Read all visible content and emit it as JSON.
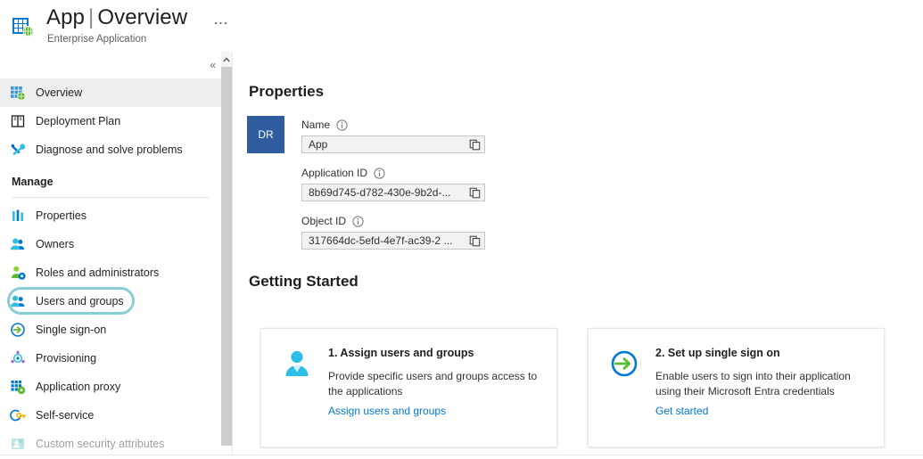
{
  "header": {
    "app_name": "App",
    "separator": "|",
    "page": "Overview",
    "subtitle": "Enterprise Application",
    "ellipsis": "…",
    "icon": "enterprise-application-icon"
  },
  "sidebar": {
    "collapse_label": "«",
    "scroll_up_label": "ⱏ",
    "items": [
      {
        "label": "Overview",
        "icon": "overview-grid-icon",
        "selected": true,
        "disabled": false
      },
      {
        "label": "Deployment Plan",
        "icon": "book-icon",
        "selected": false,
        "disabled": false
      },
      {
        "label": "Diagnose and solve problems",
        "icon": "wrench-screwdriver-icon",
        "selected": false,
        "disabled": false
      }
    ],
    "group_label": "Manage",
    "manage_items": [
      {
        "label": "Properties",
        "icon": "properties-bars-icon",
        "selected": false,
        "disabled": false,
        "highlighted": false
      },
      {
        "label": "Owners",
        "icon": "owners-people-icon",
        "selected": false,
        "disabled": false,
        "highlighted": false
      },
      {
        "label": "Roles and administrators",
        "icon": "roles-person-gear-icon",
        "selected": false,
        "disabled": false,
        "highlighted": false
      },
      {
        "label": "Users and groups",
        "icon": "users-groups-icon",
        "selected": false,
        "disabled": false,
        "highlighted": true
      },
      {
        "label": "Single sign-on",
        "icon": "single-sign-on-arrow-icon",
        "selected": false,
        "disabled": false,
        "highlighted": false
      },
      {
        "label": "Provisioning",
        "icon": "provisioning-cycle-icon",
        "selected": false,
        "disabled": false,
        "highlighted": false
      },
      {
        "label": "Application proxy",
        "icon": "application-proxy-icon",
        "selected": false,
        "disabled": false,
        "highlighted": false
      },
      {
        "label": "Self-service",
        "icon": "self-service-key-icon",
        "selected": false,
        "disabled": false,
        "highlighted": false
      },
      {
        "label": "Custom security attributes",
        "icon": "custom-security-attributes-icon",
        "selected": false,
        "disabled": true,
        "highlighted": false
      }
    ]
  },
  "main": {
    "properties_title": "Properties",
    "avatar_initials": "DR",
    "fields": [
      {
        "label": "Name",
        "value": "App",
        "info_icon": "info-icon",
        "copy_icon": "copy-icon"
      },
      {
        "label": "Application ID",
        "value": "8b69d745-d782-430e-9b2d-...",
        "info_icon": "info-icon",
        "copy_icon": "copy-icon"
      },
      {
        "label": "Object ID",
        "value": "317664dc-5efd-4e7f-ac39-2 ...",
        "info_icon": "info-icon",
        "copy_icon": "copy-icon"
      }
    ],
    "getting_started_title": "Getting Started",
    "cards": [
      {
        "title": "1. Assign users and groups",
        "description": "Provide specific users and groups access to the applications",
        "link": "Assign users and groups",
        "icon": "person-icon"
      },
      {
        "title": "2. Set up single sign on",
        "description": "Enable users to sign into their application using their Microsoft Entra credentials",
        "link": "Get started",
        "icon": "sign-on-arrow-circle-icon"
      }
    ]
  },
  "colors": {
    "accent_link": "#0078d4",
    "avatar_bg": "#2f5c9e",
    "highlight_ring": "#87ced6",
    "selected_row": "#eeeeee",
    "field_bg": "#f3f2f1"
  }
}
